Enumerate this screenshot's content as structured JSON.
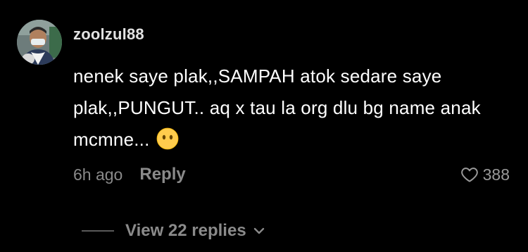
{
  "comment": {
    "username": "zoolzul88",
    "text": "nenek saye plak,,SAMPAH atok sedare saye plak,,PUNGUT.. aq x tau la org dlu bg name anak mcmne...",
    "emoji_icon": "face-without-mouth-emoji",
    "time": "6h ago",
    "reply_label": "Reply",
    "like_icon": "heart-outline-icon",
    "like_count": "388",
    "view_replies_label": "View 22 replies",
    "view_replies_icon": "chevron-down-icon"
  },
  "colors": {
    "background": "#000000",
    "text_primary": "#ffffff",
    "text_secondary": "#8a8a8a",
    "emoji_yellow": "#ffcc4d"
  }
}
